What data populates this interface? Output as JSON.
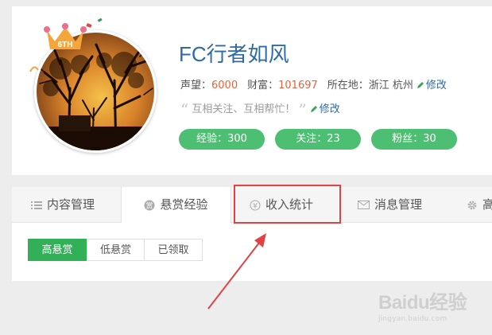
{
  "profile": {
    "name": "FC行者如风",
    "crown_badge": "6TH",
    "stats": {
      "reputation_label": "声望：",
      "reputation_value": "6000",
      "wealth_label": "财富：",
      "wealth_value": "101697",
      "location_label": "所在地：",
      "location_value": "浙江 杭州",
      "edit_label": "修改"
    },
    "motto": "互相关注、互相帮忙！",
    "motto_edit_label": "修改",
    "pills": {
      "experience": "经验：300",
      "following": "关注：23",
      "fans": "粉丝：30"
    }
  },
  "tabs": [
    {
      "label": "内容管理",
      "icon": "list-icon"
    },
    {
      "label": "悬赏经验",
      "icon": "coin-icon"
    },
    {
      "label": "收入统计",
      "icon": "yen-icon"
    },
    {
      "label": "消息管理",
      "icon": "mail-icon"
    },
    {
      "label": "高",
      "icon": "gear-icon"
    }
  ],
  "active_tab": "悬赏经验",
  "filters": [
    "高悬赏",
    "低悬赏",
    "已领取"
  ],
  "active_filter": "高悬赏",
  "watermark": {
    "main": "Baidu经验",
    "sub": "jingyan.baidu.com"
  },
  "colors": {
    "accent_green": "#4cbf72",
    "name_blue": "#2d6aa8",
    "number_orange": "#e5643b",
    "annotation_red": "#e04343"
  }
}
